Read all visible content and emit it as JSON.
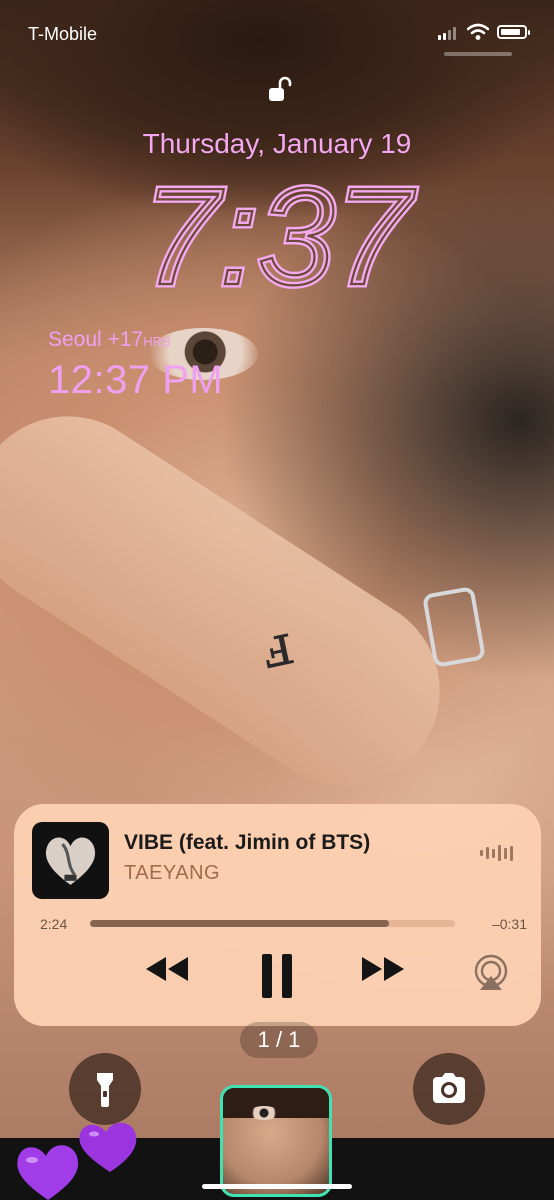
{
  "status_bar": {
    "carrier": "T-Mobile",
    "signal_bars": 4,
    "signal_bars_filled": 2,
    "battery_level": 0.9,
    "icons": [
      "cellular-signal-icon",
      "wifi-icon",
      "battery-icon"
    ]
  },
  "lock_screen": {
    "lock_state": "unlocked",
    "date": "Thursday, January 19",
    "time": "7:37",
    "accent_color": "#f4a8f0"
  },
  "world_clock": {
    "city": "Seoul",
    "offset": "+17",
    "offset_unit": "HRS",
    "time": "12:37 PM"
  },
  "now_playing": {
    "title": "VIBE (feat. Jimin of BTS)",
    "artist": "TAEYANG",
    "elapsed": "2:24",
    "remaining": "–0:31",
    "progress": 0.82,
    "background_color": "#fccfb2",
    "controls": [
      "rewind-icon",
      "pause-icon",
      "fast-forward-icon",
      "airplay-icon"
    ]
  },
  "pager": {
    "label": "1 / 1"
  },
  "bottom": {
    "left_button_icon": "flashlight-icon",
    "right_button_icon": "camera-icon"
  }
}
